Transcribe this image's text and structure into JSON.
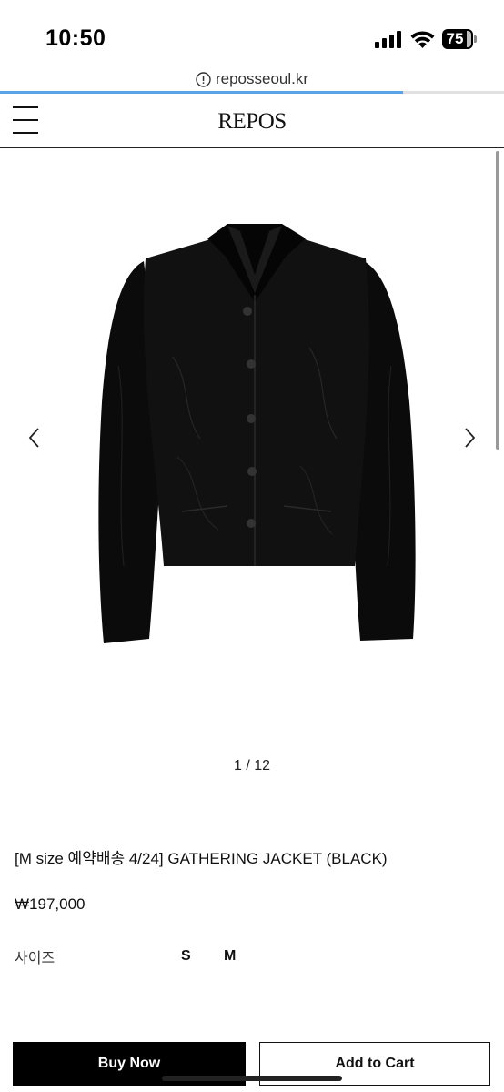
{
  "status_bar": {
    "time": "10:50",
    "battery": "75"
  },
  "browser": {
    "url": "reposseoul.kr",
    "load_progress": 0.8
  },
  "site": {
    "logo": "REPOS"
  },
  "gallery": {
    "pager": "1 / 12"
  },
  "product": {
    "title": "[M size 예약배송 4/24] GATHERING JACKET (BLACK)",
    "price": "₩197,000",
    "option_label": "사이즈",
    "sizes": [
      "S",
      "M"
    ]
  },
  "actions": {
    "buy_now": "Buy Now",
    "add_to_cart": "Add to Cart"
  },
  "colors": {
    "accent": "#5aa3e6",
    "primary_button": "#000000"
  }
}
